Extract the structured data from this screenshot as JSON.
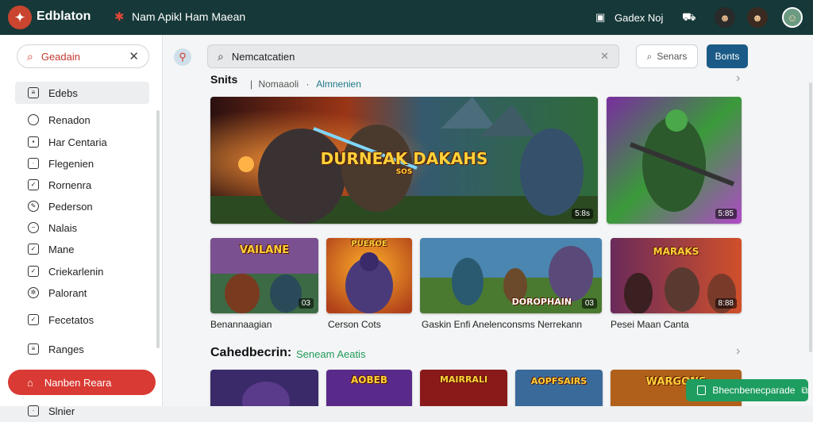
{
  "app": {
    "logo_icon": "brand-logo",
    "name": "Edblaton",
    "subtitle": "Nam Apikl Ham Maean"
  },
  "top_right": {
    "notify_label": "Gadex Noj"
  },
  "sidebar": {
    "search_value": "Geadain",
    "items": [
      {
        "label": "Edebs",
        "icon": "grid-icon"
      },
      {
        "label": "Renadon",
        "icon": "chat-icon"
      },
      {
        "label": "Har Centaria",
        "icon": "grid-icon"
      },
      {
        "label": "Flegenien",
        "icon": "square-icon"
      },
      {
        "label": "Rornenra",
        "icon": "check-icon"
      },
      {
        "label": "Pederson",
        "icon": "pen-icon"
      },
      {
        "label": "Nalais",
        "icon": "minus-icon"
      },
      {
        "label": "Mane",
        "icon": "tag-icon"
      },
      {
        "label": "Criekarlenin",
        "icon": "check-icon"
      },
      {
        "label": "Palorant",
        "icon": "gear-icon"
      },
      {
        "label": "Fecetatos",
        "icon": "check-icon"
      },
      {
        "label": "Ranges",
        "icon": "list-icon"
      }
    ],
    "promo_label": "Nanben Reara",
    "bottom_label": "Slnier"
  },
  "main": {
    "search_value": "Nemcatcatien",
    "btn_outline": "Senars",
    "btn_solid": "Bonts",
    "section1": {
      "title": "Snits",
      "crumb_a": "Nomaaoli",
      "crumb_b": "Almnenien"
    },
    "hero": {
      "art_title": "DURNEAK DAKAHS",
      "art_sub": "SOS",
      "badge": "5:8s"
    },
    "side_hero": {
      "badge": "5:85"
    },
    "row": [
      {
        "label": "Benannaagian",
        "art": "VAILANE",
        "badge": "03"
      },
      {
        "label": "Cerson Cots",
        "art": "PUEROE",
        "badge": ""
      },
      {
        "label": "Gaskin Enfi Anelenconsms Nerrekann",
        "art": "DOROPHAIN",
        "badge": "03"
      },
      {
        "label": "Pesei Maan Canta",
        "art": "MARAKS",
        "badge": "8:88"
      }
    ],
    "section2": {
      "title": "Cahedbecrin:",
      "link": "Seneam Aeatis"
    },
    "row2": [
      {
        "art": ""
      },
      {
        "art": "AOBEB"
      },
      {
        "art": "MAIRRALI"
      },
      {
        "art": "AOPFSAIRS"
      },
      {
        "art": "WARGONS"
      }
    ],
    "toast": {
      "text": "Bhecnbenecparade"
    }
  }
}
